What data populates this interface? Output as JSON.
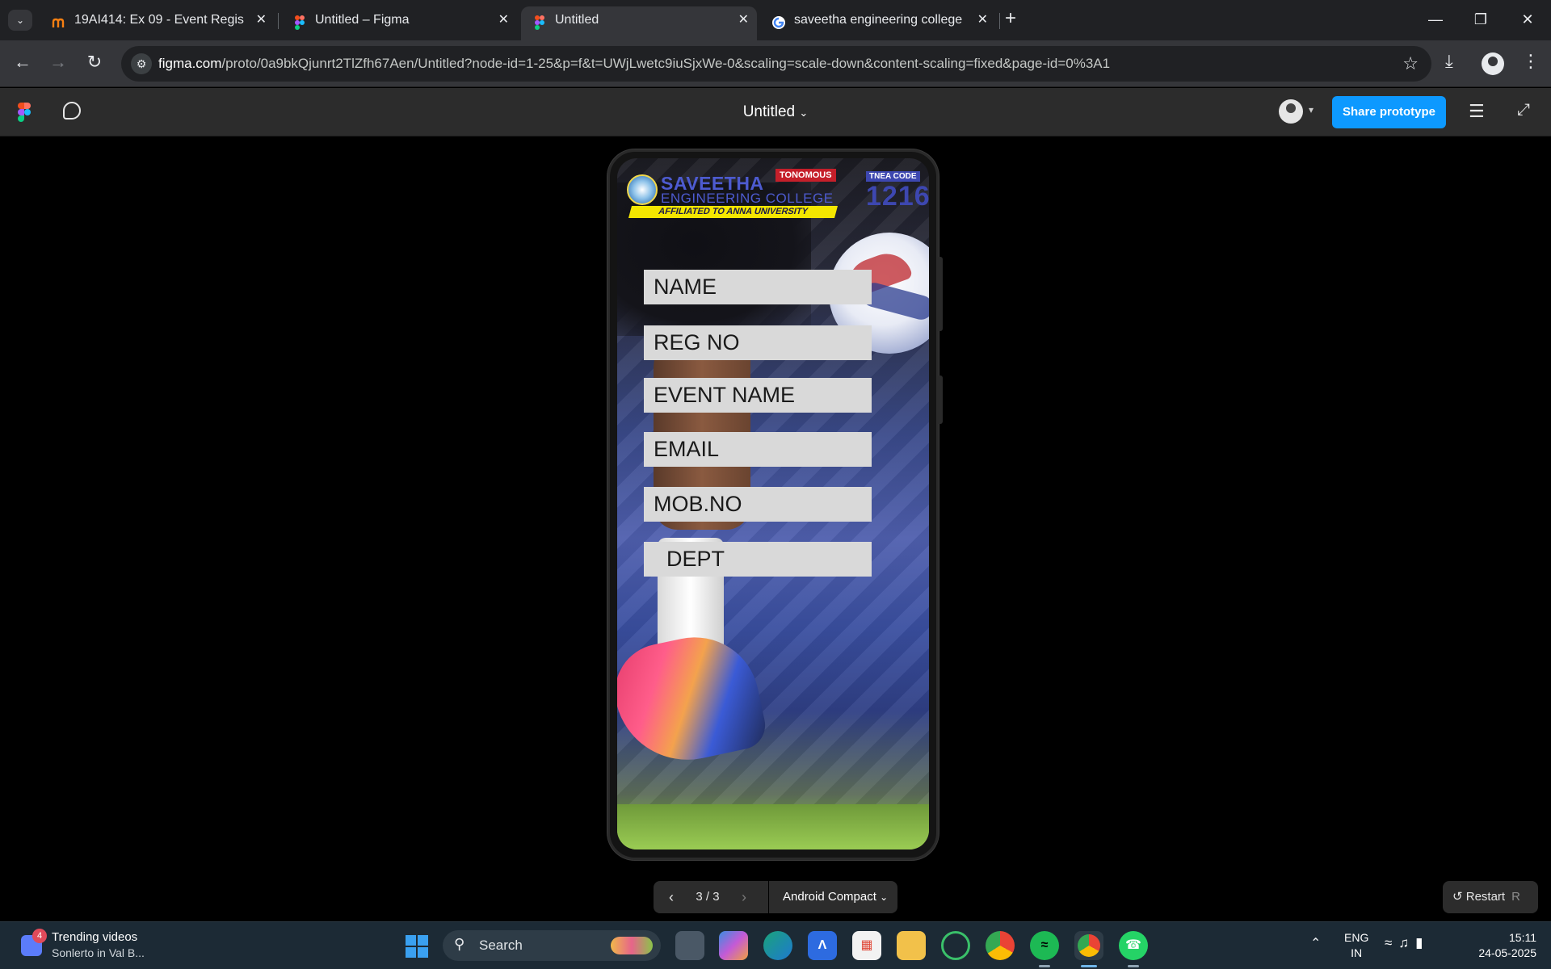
{
  "browser": {
    "tabs": [
      {
        "title": "19AI414: Ex 09 - Event Registrat",
        "favicon": "moodle-icon",
        "active": false
      },
      {
        "title": "Untitled – Figma",
        "favicon": "figma-icon",
        "active": false
      },
      {
        "title": "Untitled",
        "favicon": "figma-icon",
        "active": true
      },
      {
        "title": "saveetha engineering college -",
        "favicon": "google-icon",
        "active": false
      }
    ],
    "new_tab_symbol": "+",
    "address": {
      "host": "figma.com",
      "path": "/proto/0a9bkQjunrt2TlZfh67Aen/Untitled?node-id=1-25&p=f&t=UWjLwetc9iuSjxWe-0&scaling=scale-down&content-scaling=fixed&page-id=0%3A1"
    }
  },
  "figma_header": {
    "file_title": "Untitled",
    "share_label": "Share prototype"
  },
  "prototype": {
    "college": {
      "name_line1": "SAVEETHA",
      "name_line2": "ENGINEERING COLLEGE",
      "autonomous": "TONOMOUS",
      "affiliation": "AFFILIATED TO ANNA UNIVERSITY",
      "tnea_label": "TNEA CODE",
      "tnea_code": "1216"
    },
    "fields": [
      "NAME",
      "REG NO",
      "EVENT NAME",
      "EMAIL",
      "MOB.NO",
      "DEPT"
    ]
  },
  "prototype_controls": {
    "frame_counter": "3 / 3",
    "device": "Android Compact",
    "restart_label": "Restart",
    "restart_key": "R"
  },
  "taskbar": {
    "news_badge": "4",
    "news_title": "Trending videos",
    "news_subtitle": "Sonlerto in Val B...",
    "search_label": "Search",
    "language_line1": "ENG",
    "language_line2": "IN",
    "time": "15:11",
    "date": "24-05-2025"
  },
  "colors": {
    "share_button": "#0d99ff",
    "figma_bar": "#2c2c2c",
    "browser_chrome": "#202124",
    "field_fill": "#d9d9d9",
    "taskbar": "#1c2a35"
  }
}
